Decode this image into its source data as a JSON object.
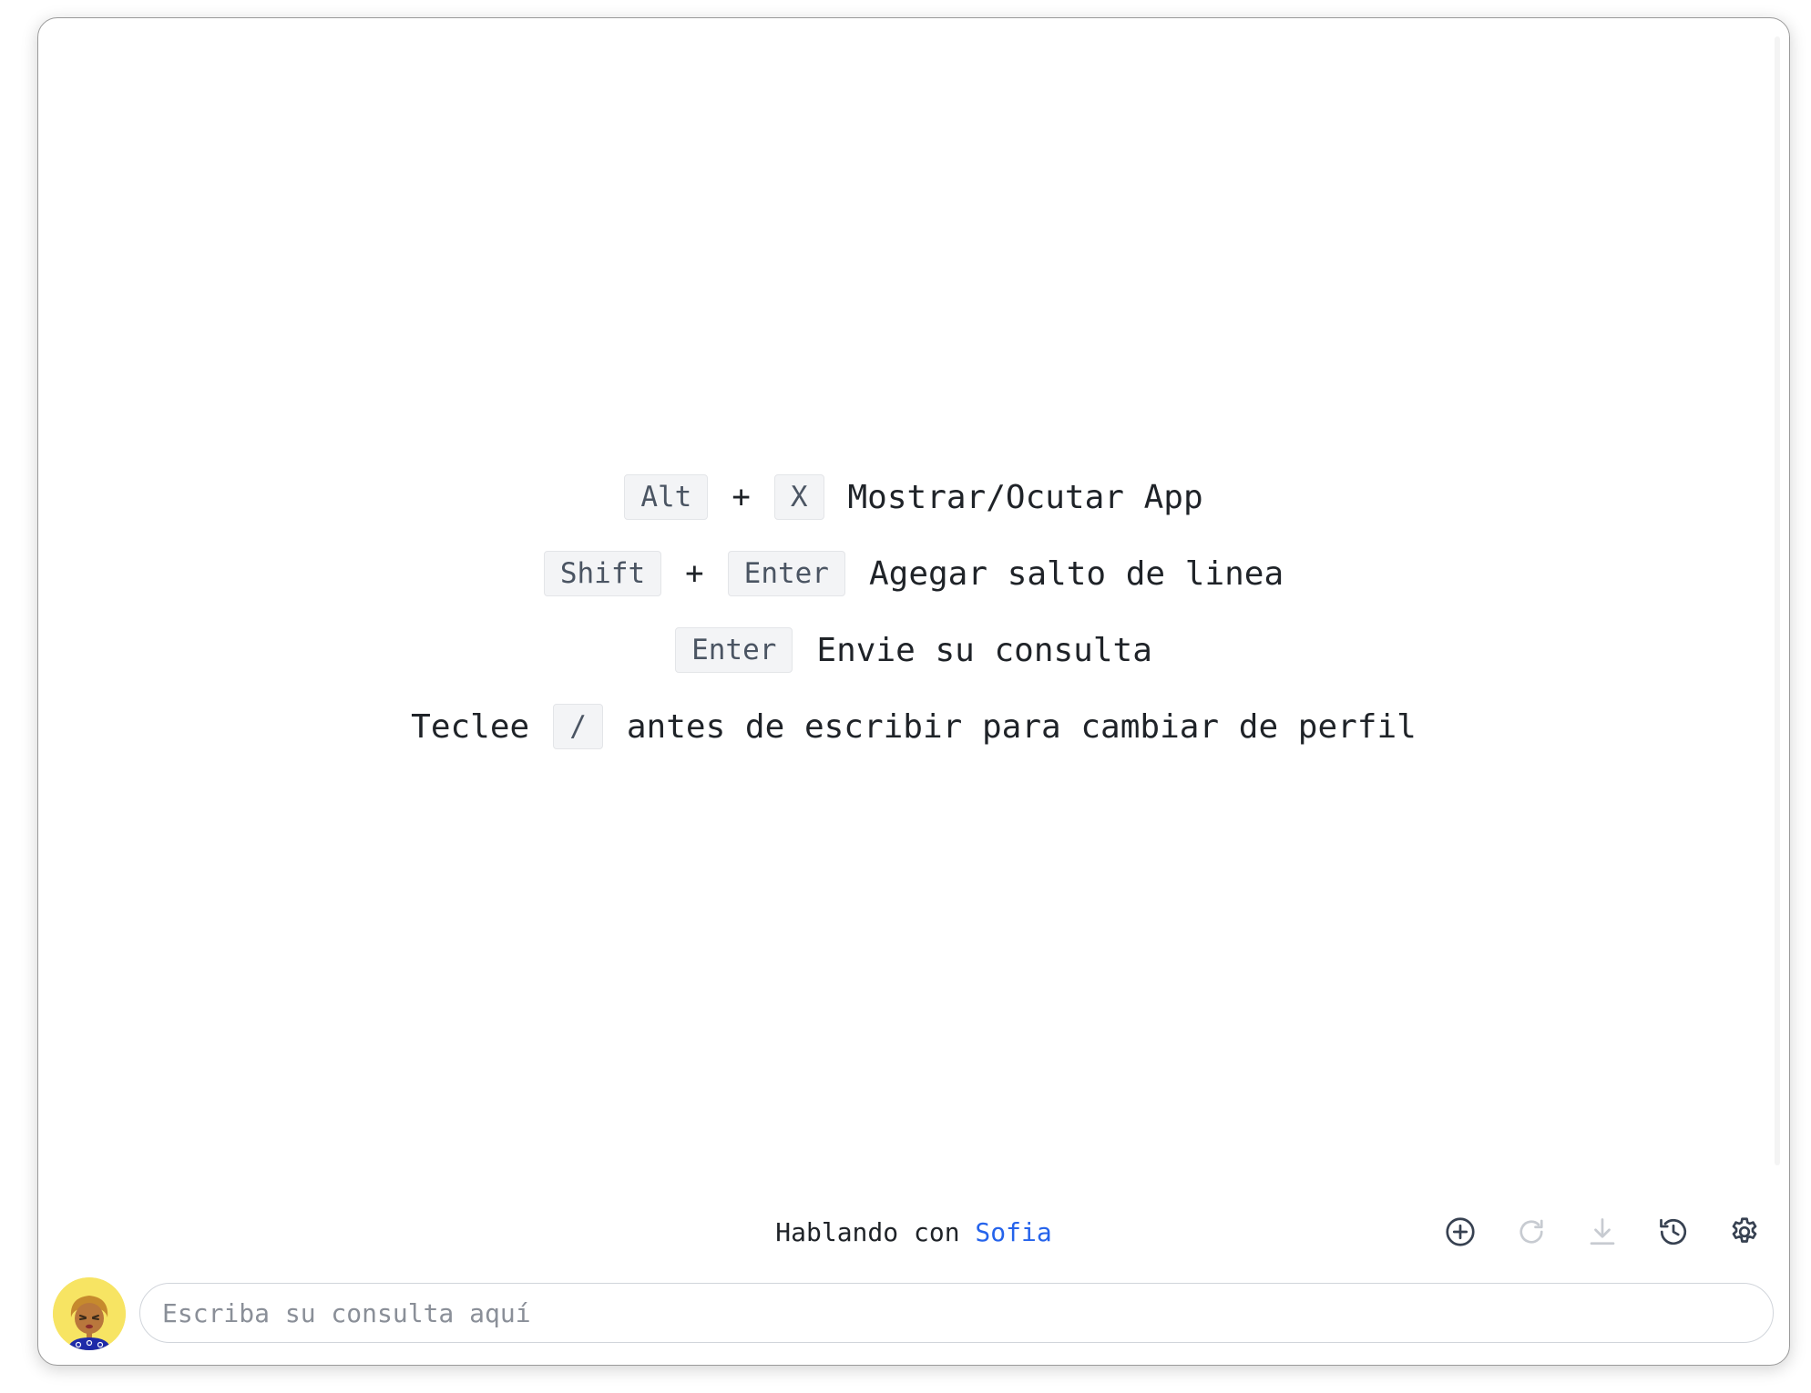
{
  "shortcuts": {
    "rows": [
      {
        "keys": [
          "Alt",
          "X"
        ],
        "joiner": "+",
        "description": "Mostrar/Ocutar App"
      },
      {
        "keys": [
          "Shift",
          "Enter"
        ],
        "joiner": "+",
        "description": "Agegar salto de linea"
      },
      {
        "keys": [
          "Enter"
        ],
        "description": "Envie su consulta"
      },
      {
        "prefix": "Teclee",
        "keys": [
          "/"
        ],
        "description": "antes de escribir para cambiar de perfil"
      }
    ]
  },
  "status": {
    "prefix": "Hablando con",
    "agent_name": "Sofia",
    "agent_color": "#2563eb"
  },
  "toolbar": {
    "icons": [
      "new-chat-icon",
      "refresh-icon",
      "download-icon",
      "history-icon",
      "settings-icon"
    ]
  },
  "composer": {
    "placeholder": "Escriba su consulta aquí",
    "value": ""
  },
  "avatar": {
    "icon": "user-avatar-icon",
    "background": "#f7e463"
  }
}
